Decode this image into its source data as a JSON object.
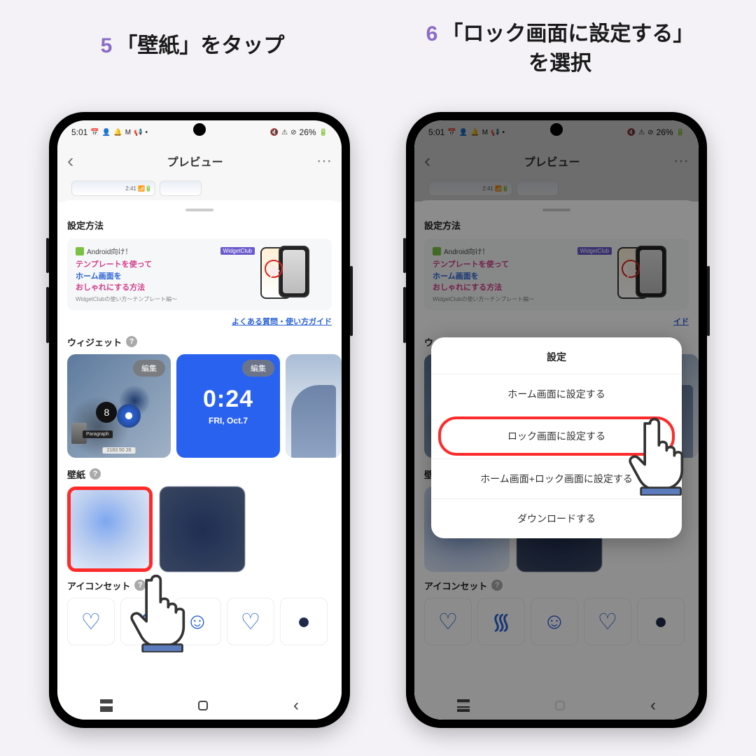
{
  "step5": {
    "number": "5",
    "title": "「壁紙」をタップ"
  },
  "step6": {
    "number": "6",
    "title_line1": "「ロック画面に設定する」",
    "title_line2": "を選択"
  },
  "status": {
    "time": "5:01",
    "battery": "26%"
  },
  "header": {
    "title": "プレビュー"
  },
  "mini_preview_time": "2:41",
  "sheet": {
    "title": "設定方法",
    "banner": {
      "android_label": "Android向け！",
      "widgetclub_label": "WidgetClub",
      "line1": "テンプレートを使って",
      "line2": "ホーム画面を",
      "line3": "おしゃれにする方法",
      "sub": "WidgetClubの使い方〜テンプレート編〜"
    },
    "faq_link": "よくある質問・使い方ガイド",
    "widgets_label": "ウィジェット",
    "edit_label": "編集",
    "clock_widget": {
      "time": "0:24",
      "date": "FRI, Oct.7"
    },
    "eight_ball": "8",
    "paragraph_tag": "Paragraph",
    "card_bottom_tag": "2183 50 26",
    "wallpaper_label": "壁紙",
    "iconset_label": "アイコンセット"
  },
  "modal": {
    "title": "設定",
    "options": [
      "ホーム画面に設定する",
      "ロック画面に設定する",
      "ホーム画面+ロック画面に設定する",
      "ダウンロードする"
    ]
  },
  "help_mark": "?"
}
